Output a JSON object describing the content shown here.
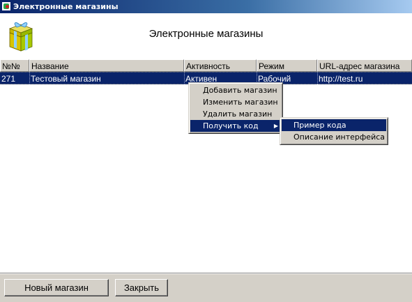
{
  "window": {
    "title": "Электронные магазины"
  },
  "header": {
    "title": "Электронные магазины",
    "icon": "gift-box-icon"
  },
  "table": {
    "columns": [
      "№№",
      "Название",
      "Активность",
      "Режим",
      "URL-адрес магазина"
    ],
    "rows": [
      {
        "id": "271",
        "name": "Тестовый магазин",
        "activity": "Активен",
        "mode": "Рабочий",
        "url": "http://test.ru"
      }
    ]
  },
  "context_menu": {
    "items": [
      "Добавить магазин",
      "Изменить магазин",
      "Удалить магазин",
      "Получить код"
    ],
    "highlighted": "Получить код",
    "submenu": {
      "items": [
        "Пример кода",
        "Описание интерфейса"
      ],
      "highlighted": "Пример кода"
    }
  },
  "footer": {
    "new_store": "Новый магазин",
    "close": "Закрыть"
  },
  "colors": {
    "selection": "#0a246a",
    "face": "#d4d0c8",
    "title_gradient_end": "#a6caf0"
  }
}
